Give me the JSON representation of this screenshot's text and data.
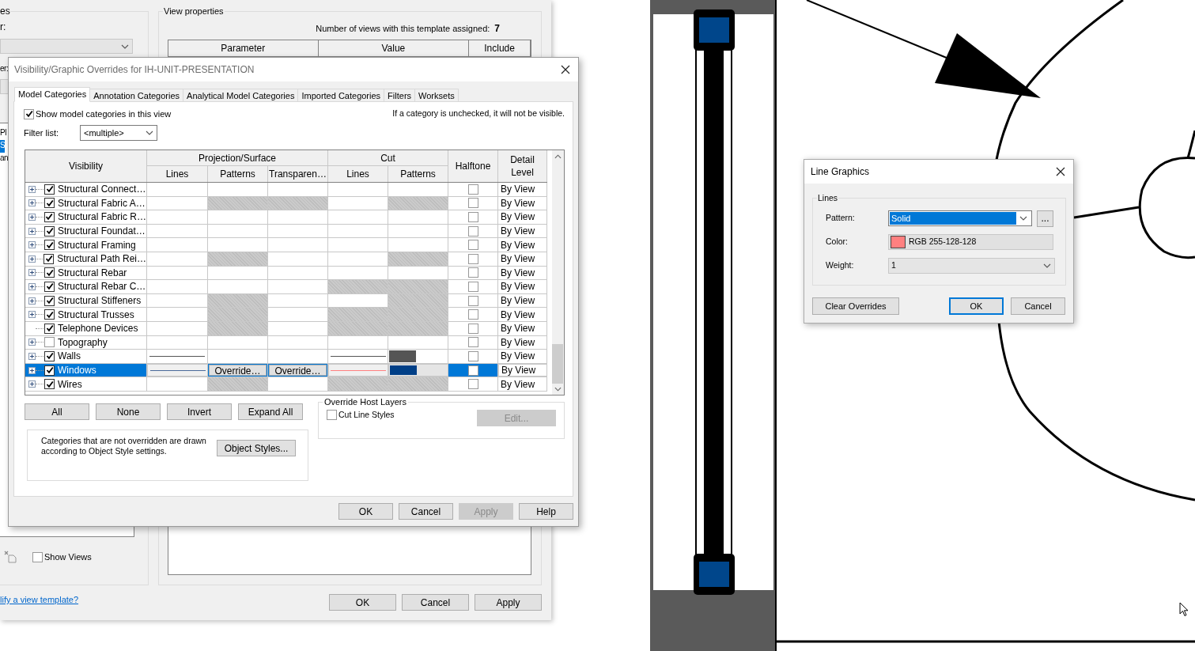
{
  "template_dialog": {
    "left_panel": {
      "group_title": "es",
      "field_label": "r:",
      "second_label": "er:",
      "list_items": [
        {
          "label": "Pl",
          "selected": false
        },
        {
          "label": "S",
          "selected": true
        },
        {
          "label": "an",
          "selected": false
        }
      ]
    },
    "show_views": {
      "label": "Show Views",
      "checked": false
    },
    "help_link": "lify a view template?",
    "view_properties": {
      "title": "View properties",
      "views_count_label": "Number of views with this template assigned:",
      "views_count": "7",
      "columns": [
        "Parameter",
        "Value",
        "Include"
      ]
    },
    "buttons": [
      {
        "label": "OK",
        "disabled": false
      },
      {
        "label": "Cancel",
        "disabled": false
      },
      {
        "label": "Apply",
        "disabled": false
      }
    ]
  },
  "vg_dialog": {
    "title": "Visibility/Graphic Overrides for IH-UNIT-PRESENTATION",
    "tabs": [
      {
        "label": "Model Categories",
        "selected": true
      },
      {
        "label": "Annotation Categories",
        "selected": false
      },
      {
        "label": "Analytical Model Categories",
        "selected": false
      },
      {
        "label": "Imported Categories",
        "selected": false
      },
      {
        "label": "Filters",
        "selected": false
      },
      {
        "label": "Worksets",
        "selected": false
      }
    ],
    "show_categories": {
      "label": "Show model categories in this view",
      "checked": true
    },
    "hint": "If a category is unchecked, it will not be visible.",
    "filter_list": {
      "label": "Filter list:",
      "value": "<multiple>"
    },
    "table": {
      "visibility": "Visibility",
      "groups": [
        {
          "label": "Projection/Surface",
          "columns": [
            "Lines",
            "Patterns",
            "Transparen…"
          ]
        },
        {
          "label": "Cut",
          "columns": [
            "Lines",
            "Patterns"
          ]
        }
      ],
      "halftone": "Halftone",
      "detail_level": "Detail Level",
      "rows": [
        {
          "name": "Structural Connect…",
          "expandable": true,
          "checked": true,
          "selected": false,
          "cells": [
            {
              "kind": "blank"
            },
            {
              "kind": "blank"
            },
            {
              "kind": "blank"
            },
            {
              "kind": "blank"
            },
            {
              "kind": "blank"
            }
          ],
          "halftone": false,
          "detail_level": "By View"
        },
        {
          "name": "Structural Fabric A…",
          "expandable": true,
          "checked": true,
          "selected": false,
          "cells": [
            {
              "kind": "blank"
            },
            {
              "kind": "na"
            },
            {
              "kind": "na"
            },
            {
              "kind": "blank"
            },
            {
              "kind": "na"
            }
          ],
          "halftone": false,
          "detail_level": "By View"
        },
        {
          "name": "Structural Fabric R…",
          "expandable": true,
          "checked": true,
          "selected": false,
          "cells": [
            {
              "kind": "blank"
            },
            {
              "kind": "blank"
            },
            {
              "kind": "blank"
            },
            {
              "kind": "blank"
            },
            {
              "kind": "blank"
            }
          ],
          "halftone": false,
          "detail_level": "By View"
        },
        {
          "name": "Structural Foundat…",
          "expandable": true,
          "checked": true,
          "selected": false,
          "cells": [
            {
              "kind": "blank"
            },
            {
              "kind": "blank"
            },
            {
              "kind": "blank"
            },
            {
              "kind": "blank"
            },
            {
              "kind": "blank"
            }
          ],
          "halftone": false,
          "detail_level": "By View"
        },
        {
          "name": "Structural Framing",
          "expandable": true,
          "checked": true,
          "selected": false,
          "cells": [
            {
              "kind": "blank"
            },
            {
              "kind": "blank"
            },
            {
              "kind": "blank"
            },
            {
              "kind": "blank"
            },
            {
              "kind": "blank"
            }
          ],
          "halftone": false,
          "detail_level": "By View"
        },
        {
          "name": "Structural Path Rei…",
          "expandable": true,
          "checked": true,
          "selected": false,
          "cells": [
            {
              "kind": "blank"
            },
            {
              "kind": "na"
            },
            {
              "kind": "blank"
            },
            {
              "kind": "blank"
            },
            {
              "kind": "na"
            }
          ],
          "halftone": false,
          "detail_level": "By View"
        },
        {
          "name": "Structural Rebar",
          "expandable": true,
          "checked": true,
          "selected": false,
          "cells": [
            {
              "kind": "blank"
            },
            {
              "kind": "blank"
            },
            {
              "kind": "blank"
            },
            {
              "kind": "blank"
            },
            {
              "kind": "blank"
            }
          ],
          "halftone": false,
          "detail_level": "By View"
        },
        {
          "name": "Structural Rebar C…",
          "expandable": true,
          "checked": true,
          "selected": false,
          "cells": [
            {
              "kind": "blank"
            },
            {
              "kind": "blank"
            },
            {
              "kind": "blank"
            },
            {
              "kind": "na"
            },
            {
              "kind": "na"
            }
          ],
          "halftone": false,
          "detail_level": "By View"
        },
        {
          "name": "Structural Stiffeners",
          "expandable": true,
          "checked": true,
          "selected": false,
          "cells": [
            {
              "kind": "blank"
            },
            {
              "kind": "na"
            },
            {
              "kind": "blank"
            },
            {
              "kind": "blank"
            },
            {
              "kind": "na"
            }
          ],
          "halftone": false,
          "detail_level": "By View"
        },
        {
          "name": "Structural Trusses",
          "expandable": true,
          "checked": true,
          "selected": false,
          "cells": [
            {
              "kind": "blank"
            },
            {
              "kind": "na"
            },
            {
              "kind": "blank"
            },
            {
              "kind": "na"
            },
            {
              "kind": "na"
            }
          ],
          "halftone": false,
          "detail_level": "By View"
        },
        {
          "name": "Telephone Devices",
          "expandable": false,
          "checked": true,
          "selected": false,
          "cells": [
            {
              "kind": "blank"
            },
            {
              "kind": "na"
            },
            {
              "kind": "blank"
            },
            {
              "kind": "na"
            },
            {
              "kind": "na"
            }
          ],
          "halftone": false,
          "detail_level": "By View"
        },
        {
          "name": "Topography",
          "expandable": true,
          "checked": false,
          "selected": false,
          "cells": [
            {
              "kind": "blank"
            },
            {
              "kind": "blank"
            },
            {
              "kind": "blank"
            },
            {
              "kind": "blank"
            },
            {
              "kind": "blank"
            }
          ],
          "halftone": false,
          "detail_level": "By View"
        },
        {
          "name": "Walls",
          "expandable": true,
          "checked": true,
          "selected": false,
          "cells": [
            {
              "kind": "line",
              "color": "#555555"
            },
            {
              "kind": "blank"
            },
            {
              "kind": "blank"
            },
            {
              "kind": "line",
              "color": "#555555"
            },
            {
              "kind": "swatch",
              "color": "#555555"
            }
          ],
          "halftone": false,
          "detail_level": "By View"
        },
        {
          "name": "Windows",
          "expandable": true,
          "checked": true,
          "selected": true,
          "cells": [
            {
              "kind": "line",
              "color": "#4a6a9a"
            },
            {
              "kind": "button",
              "label": "Override…"
            },
            {
              "kind": "button",
              "label": "Override…"
            },
            {
              "kind": "line",
              "color": "#ff8080"
            },
            {
              "kind": "swatch",
              "color": "#003f87"
            }
          ],
          "halftone": false,
          "detail_level": "By View"
        },
        {
          "name": "Wires",
          "expandable": true,
          "checked": true,
          "selected": false,
          "cells": [
            {
              "kind": "blank"
            },
            {
              "kind": "na"
            },
            {
              "kind": "blank"
            },
            {
              "kind": "na"
            },
            {
              "kind": "na"
            }
          ],
          "halftone": false,
          "detail_level": "By View"
        }
      ]
    },
    "row_buttons": [
      "All",
      "None",
      "Invert",
      "Expand All"
    ],
    "note": {
      "text": "Categories that are not overridden are drawn according to Object Style settings.",
      "button": "Object Styles..."
    },
    "override_host_layers": {
      "title": "Override Host Layers",
      "checkbox": {
        "label": "Cut Line Styles",
        "checked": false
      },
      "button": {
        "label": "Edit...",
        "disabled": true
      }
    },
    "buttons": [
      {
        "label": "OK",
        "disabled": false
      },
      {
        "label": "Cancel",
        "disabled": false
      },
      {
        "label": "Apply",
        "disabled": true
      },
      {
        "label": "Help",
        "disabled": false
      }
    ]
  },
  "line_graphics": {
    "title": "Line Graphics",
    "group": "Lines",
    "pattern": {
      "label": "Pattern:",
      "value": "Solid"
    },
    "more_button": "...",
    "color": {
      "label": "Color:",
      "value": "RGB 255-128-128",
      "color": "#ff8080"
    },
    "weight": {
      "label": "Weight:",
      "value": "1"
    },
    "buttons": [
      {
        "label": "Clear Overrides",
        "default": false
      },
      {
        "label": "OK",
        "default": true
      },
      {
        "label": "Cancel",
        "default": false
      }
    ]
  }
}
